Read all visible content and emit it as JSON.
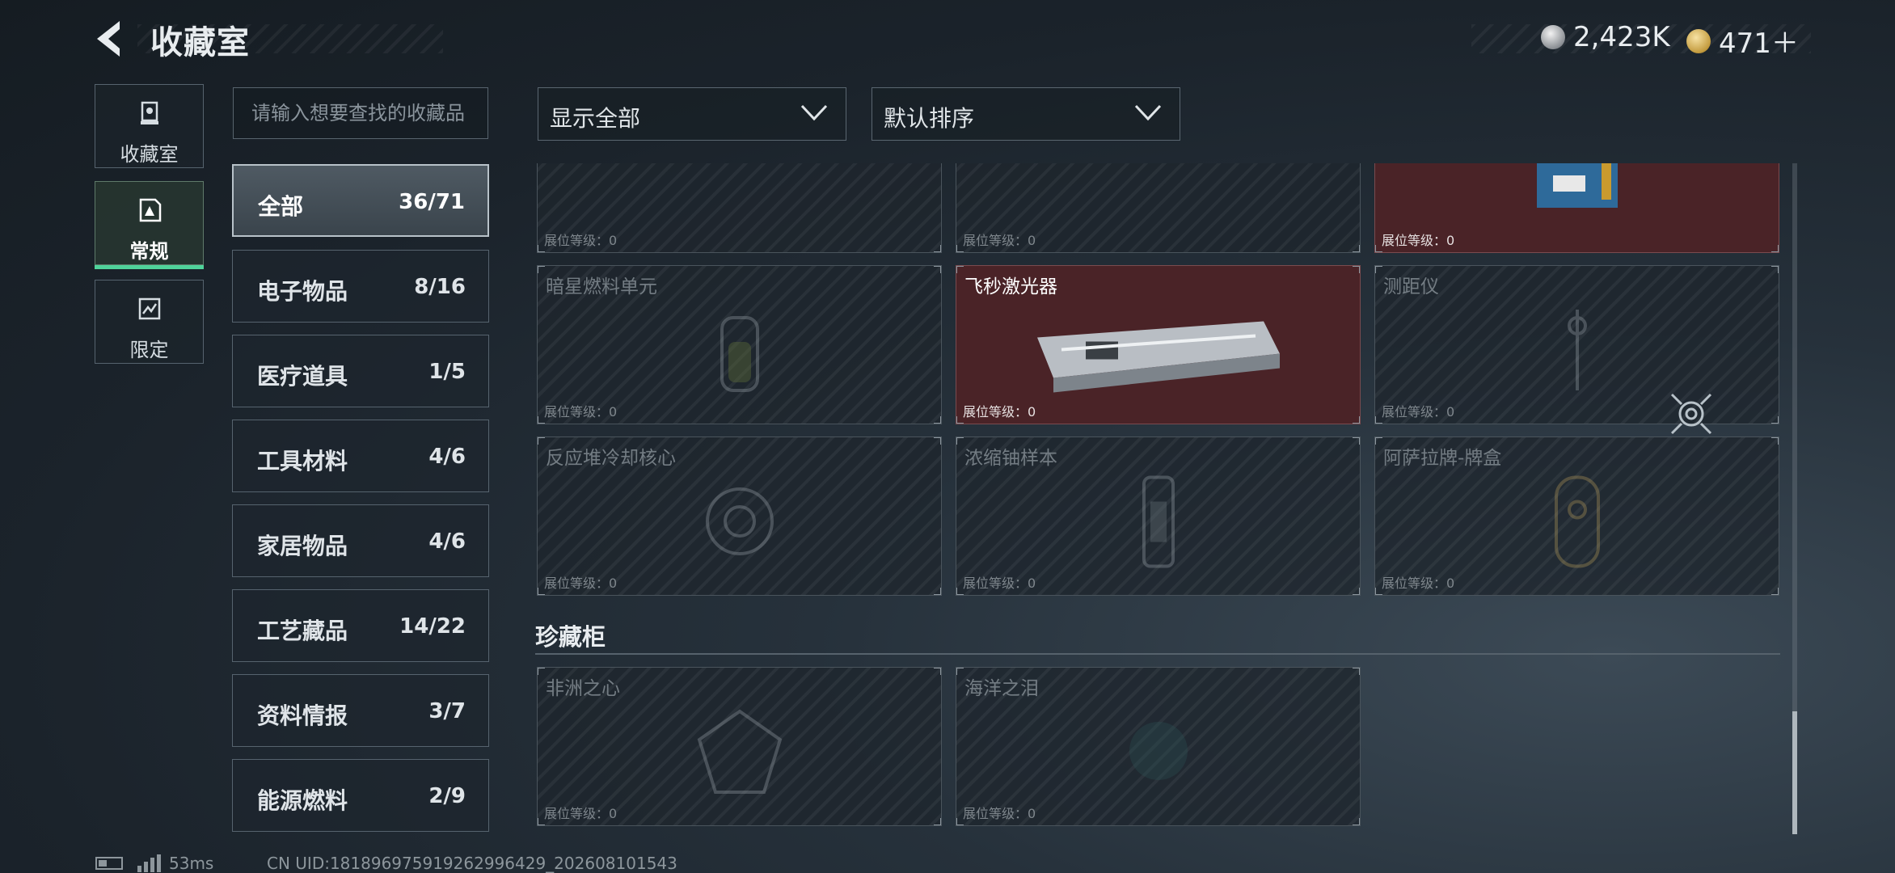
{
  "header": {
    "title": "收藏室",
    "currency": [
      {
        "icon": "silver-coin-icon",
        "value": "2,423K"
      },
      {
        "icon": "gold-coin-icon",
        "value": "471＋"
      }
    ]
  },
  "side_tabs": [
    {
      "label": "收藏室",
      "icon": "trophy-icon",
      "active": false
    },
    {
      "label": "常规",
      "icon": "collection-icon",
      "active": true
    },
    {
      "label": "限定",
      "icon": "limited-icon",
      "active": false
    }
  ],
  "search": {
    "placeholder": "请输入想要查找的收藏品"
  },
  "categories": [
    {
      "name": "全部",
      "count": "36/71",
      "active": true
    },
    {
      "name": "电子物品",
      "count": "8/16"
    },
    {
      "name": "医疗道具",
      "count": "1/5"
    },
    {
      "name": "工具材料",
      "count": "4/6"
    },
    {
      "name": "家居物品",
      "count": "4/6"
    },
    {
      "name": "工艺藏品",
      "count": "14/22"
    },
    {
      "name": "资料情报",
      "count": "3/7"
    },
    {
      "name": "能源燃料",
      "count": "2/9"
    }
  ],
  "filters": {
    "display": "显示全部",
    "sort": "默认排序"
  },
  "level_label": "展位等级：0",
  "grid_rows": [
    [
      {
        "name": "",
        "owned": false
      },
      {
        "name": "",
        "owned": false
      },
      {
        "name": "",
        "owned": true
      }
    ],
    [
      {
        "name": "暗星燃料单元",
        "owned": false
      },
      {
        "name": "飞秒激光器",
        "owned": true
      },
      {
        "name": "测距仪",
        "owned": false
      }
    ],
    [
      {
        "name": "反应堆冷却核心",
        "owned": false
      },
      {
        "name": "浓缩铀样本",
        "owned": false
      },
      {
        "name": "阿萨拉牌-牌盒",
        "owned": false
      }
    ]
  ],
  "section": {
    "title": "珍藏柜"
  },
  "treasure_items": [
    {
      "name": "非洲之心",
      "owned": false
    },
    {
      "name": "海洋之泪",
      "owned": false
    }
  ],
  "footer": {
    "ping": "53ms",
    "uid": "CN UID:18189697591926299642​9_202608101543"
  }
}
